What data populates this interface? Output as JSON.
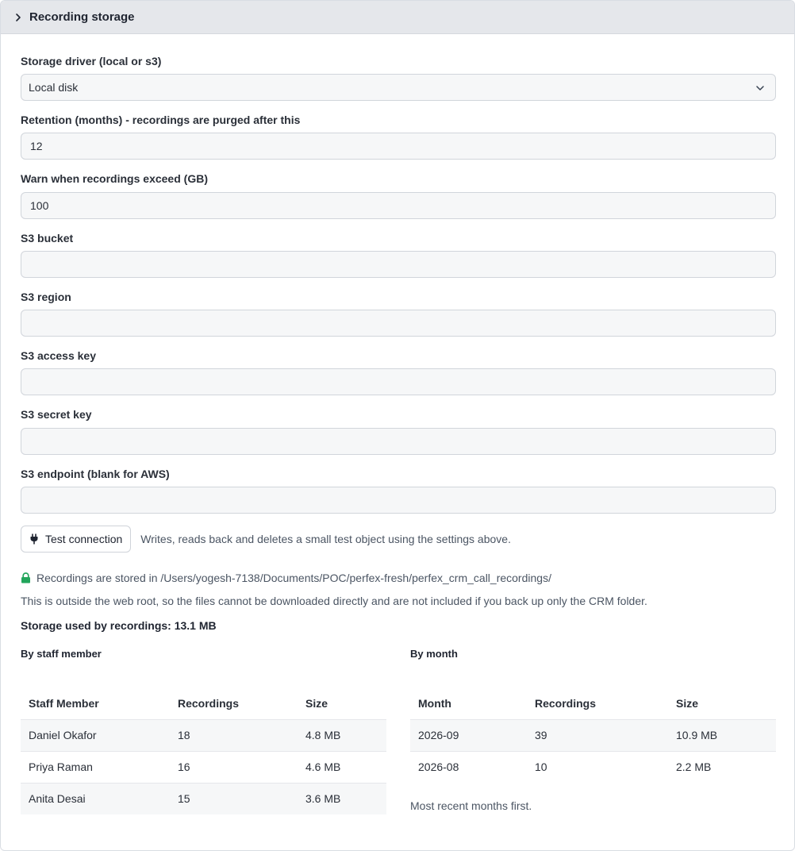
{
  "panel": {
    "title": "Recording storage"
  },
  "fields": {
    "driver": {
      "label": "Storage driver (local or s3)",
      "value": "Local disk"
    },
    "retention": {
      "label": "Retention (months) - recordings are purged after this",
      "value": "12"
    },
    "warn": {
      "label": "Warn when recordings exceed (GB)",
      "value": "100"
    },
    "bucket": {
      "label": "S3 bucket",
      "value": ""
    },
    "region": {
      "label": "S3 region",
      "value": ""
    },
    "access_key": {
      "label": "S3 access key",
      "value": ""
    },
    "secret_key": {
      "label": "S3 secret key",
      "value": ""
    },
    "endpoint": {
      "label": "S3 endpoint (blank for AWS)",
      "value": ""
    }
  },
  "test": {
    "button_label": "Test connection",
    "hint": "Writes, reads back and deletes a small test object using the settings above."
  },
  "storage": {
    "location": "Recordings are stored in /Users/yogesh-7138/Documents/POC/perfex-fresh/perfex_crm_call_recordings/",
    "note": "This is outside the web root, so the files cannot be downloaded directly and are not included if you back up only the CRM folder.",
    "used": "Storage used by recordings: 13.1 MB",
    "lock_color": "#22a55b"
  },
  "by_staff": {
    "heading": "By staff member",
    "columns": [
      "Staff Member",
      "Recordings",
      "Size"
    ],
    "rows": [
      [
        "Daniel Okafor",
        "18",
        "4.8 MB"
      ],
      [
        "Priya Raman",
        "16",
        "4.6 MB"
      ],
      [
        "Anita Desai",
        "15",
        "3.6 MB"
      ]
    ]
  },
  "by_month": {
    "heading": "By month",
    "columns": [
      "Month",
      "Recordings",
      "Size"
    ],
    "rows": [
      [
        "2026-09",
        "39",
        "10.9 MB"
      ],
      [
        "2026-08",
        "10",
        "2.2 MB"
      ]
    ],
    "footnote": "Most recent months first."
  }
}
